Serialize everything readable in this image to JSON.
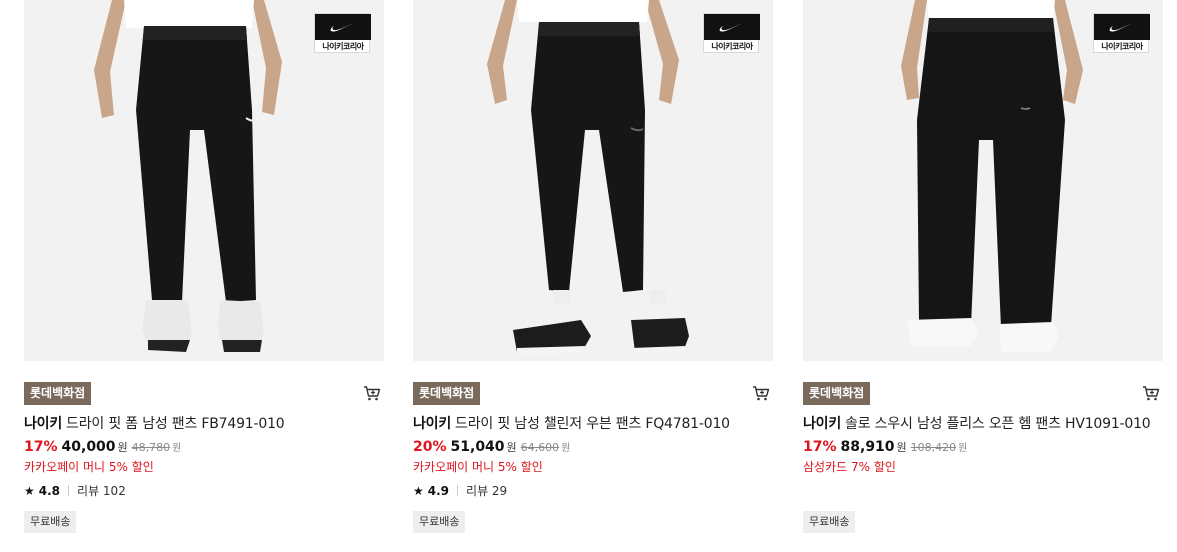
{
  "products": [
    {
      "brand_badge": "나이키코리아",
      "store": "롯데백화점",
      "brand": "나이키",
      "name": "드라이 핏 폼 남성 팬츠 FB7491-010",
      "discount": "17%",
      "price": "40,000",
      "currency": "원",
      "original_price": "48,780",
      "promo": "카카오페이 머니 5% 할인",
      "rating": "4.8",
      "review_label": "리뷰 102",
      "shipping": "무료배송"
    },
    {
      "brand_badge": "나이키코리아",
      "store": "롯데백화점",
      "brand": "나이키",
      "name": "드라이 핏 남성 챌린저 우븐 팬츠 FQ4781-010",
      "discount": "20%",
      "price": "51,040",
      "currency": "원",
      "original_price": "64,600",
      "promo": "카카오페이 머니 5% 할인",
      "rating": "4.9",
      "review_label": "리뷰 29",
      "shipping": "무료배송"
    },
    {
      "brand_badge": "나이키코리아",
      "store": "롯데백화점",
      "brand": "나이키",
      "name": "솔로 스우시 남성 플리스 오픈 헴 팬츠 HV1091-010",
      "discount": "17%",
      "price": "88,910",
      "currency": "원",
      "original_price": "108,420",
      "promo": "삼성카드 7% 할인",
      "shipping": "무료배송"
    }
  ],
  "icons": {
    "cart": "cart-icon",
    "star": "star-icon",
    "swoosh": "nike-swoosh-icon"
  },
  "colors": {
    "store_tag": "#7a6a5b",
    "discount": "#e0141e",
    "promo": "#e0141e"
  }
}
